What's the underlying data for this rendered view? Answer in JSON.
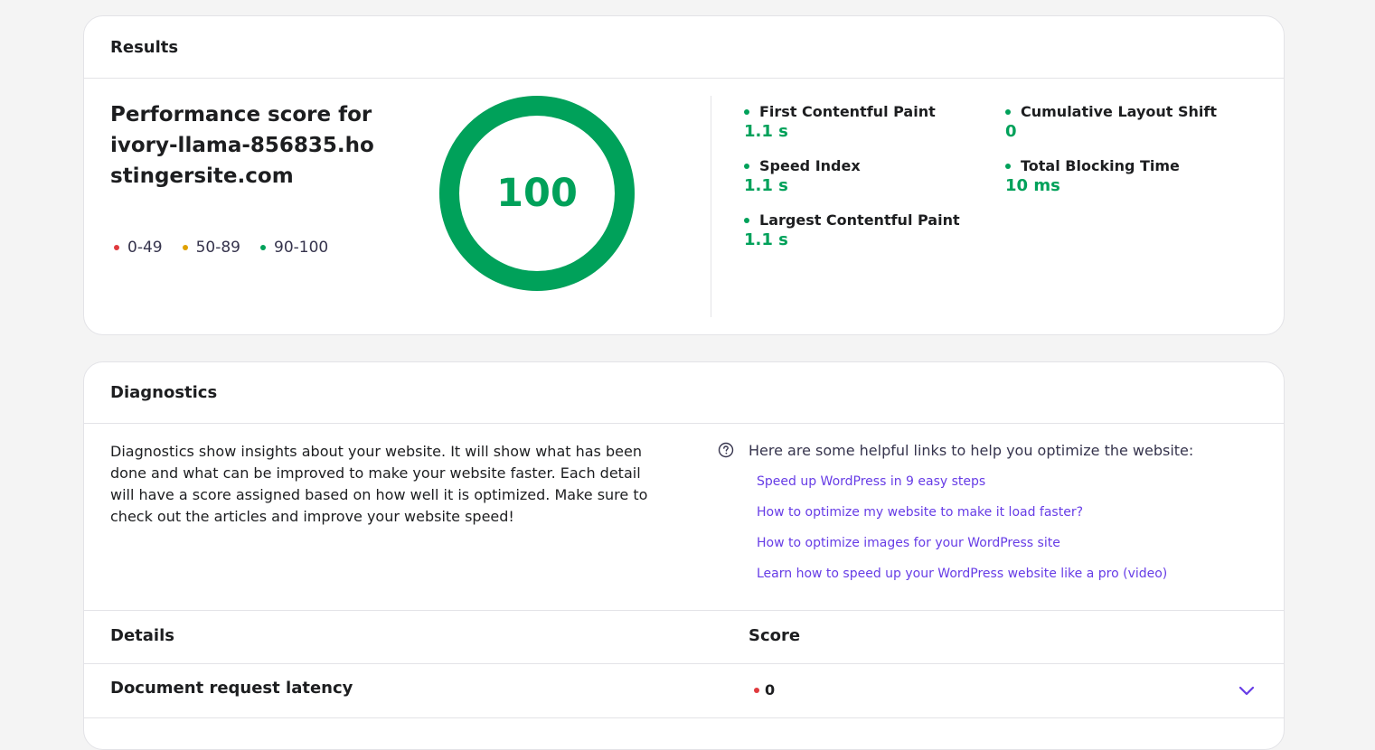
{
  "results": {
    "title": "Results",
    "perf_title": "Performance score for ivory-llama-856835.hostingersite.com",
    "legend": [
      {
        "label": "0-49",
        "color": "#e03a3e"
      },
      {
        "label": "50-89",
        "color": "#e0a100"
      },
      {
        "label": "90-100",
        "color": "#00a15a"
      }
    ],
    "score": "100",
    "score_fraction": 1.0,
    "metrics": [
      {
        "name": "First Contentful Paint",
        "value": "1.1 s"
      },
      {
        "name": "Speed Index",
        "value": "1.1 s"
      },
      {
        "name": "Largest Contentful Paint",
        "value": "1.1 s"
      },
      {
        "name": "Cumulative Layout Shift",
        "value": "0"
      },
      {
        "name": "Total Blocking Time",
        "value": "10 ms"
      }
    ]
  },
  "diagnostics": {
    "title": "Diagnostics",
    "description": "Diagnostics show insights about your website. It will show what has been done and what can be improved to make your website faster. Each detail will have a score assigned based on how well it is optimized. Make sure to check out the articles and improve your website speed!",
    "help_title": "Here are some helpful links to help you optimize the website:",
    "links": [
      "Speed up WordPress in 9 easy steps",
      "How to optimize my website to make it load faster?",
      "How to optimize images for your WordPress site",
      "Learn how to speed up your WordPress website like a pro (video)"
    ],
    "table": {
      "col_details": "Details",
      "col_score": "Score",
      "rows": [
        {
          "name": "Document request latency",
          "score": "0",
          "status_color": "#e03a3e"
        }
      ]
    }
  },
  "colors": {
    "accent": "#673de6",
    "good": "#00a15a"
  }
}
